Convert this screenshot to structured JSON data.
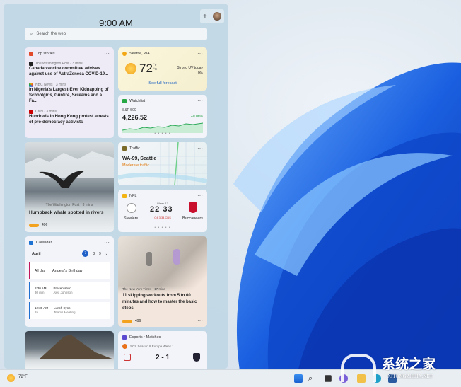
{
  "header": {
    "time": "9:00 AM",
    "add": "+",
    "search_placeholder": "Search the web"
  },
  "top_stories": {
    "title": "Top stories",
    "items": [
      {
        "source": "The Washington Post · 3 mins",
        "headline": "Canada vaccine committee advises against use of AstraZeneca COVID-19..."
      },
      {
        "source": "NBC News · 3 mins",
        "headline": "In Nigeria's Largest-Ever Kidnapping of Schoolgirls, Gunfire, Screams and a Fa..."
      },
      {
        "source": "CNN · 3 mins",
        "headline": "Hundreds in Hong Kong protest arrests of pro-democracy activists"
      }
    ]
  },
  "weather": {
    "title": "Seattle, WA",
    "temp": "72",
    "unit_f": "°F",
    "unit_c": "°C",
    "condition": "Strong UV today",
    "precip": "0%",
    "link": "See full forecast"
  },
  "watchlist": {
    "title": "Watchlist",
    "index": "S&P 500",
    "value": "4,226.52",
    "change": "+0.08%"
  },
  "whale": {
    "source": "The Washington Post · 3 mins",
    "headline": "Humpback whale spotted in rivers",
    "reactions": "496"
  },
  "traffic": {
    "title": "Traffic",
    "road": "WA-99, Seattle",
    "status": "Moderate traffic"
  },
  "nfl": {
    "title": "NFL",
    "week": "Week 17",
    "home": "Steelers",
    "away": "Buccaneers",
    "home_score": "22",
    "away_score": "33",
    "status": "Q4 3:34 CBS"
  },
  "calendar": {
    "title": "Calendar",
    "month": "April",
    "days": [
      "7",
      "8",
      "9"
    ],
    "events": [
      {
        "time": "All day",
        "dur": "",
        "title": "Angela's Birthday",
        "sub": "",
        "color": "#c2185b"
      },
      {
        "time": "8:30 AM",
        "dur": "30 min",
        "title": "Presentation",
        "sub": "Alex Johnson",
        "color": "#1e6fd0"
      },
      {
        "time": "12:30 AM",
        "dur": "1h",
        "title": "Lunch Sync",
        "sub": "Teams Meeting",
        "color": "#1e6fd0"
      }
    ]
  },
  "skipping": {
    "source": "The New York Times · 17 mins",
    "headline": "11 skipping workouts from 5 to 60 minutes and how to master the basic steps",
    "reactions": "496"
  },
  "esports": {
    "title": "Esports • Matches",
    "event": "SCS Season 8 Europe Week 1",
    "score": "2 - 1"
  },
  "taskbar": {
    "weather_temp": "72°F"
  },
  "watermark": {
    "text": "系统之家",
    "url": "XITONGZHIJIA.NET"
  },
  "more": "···"
}
